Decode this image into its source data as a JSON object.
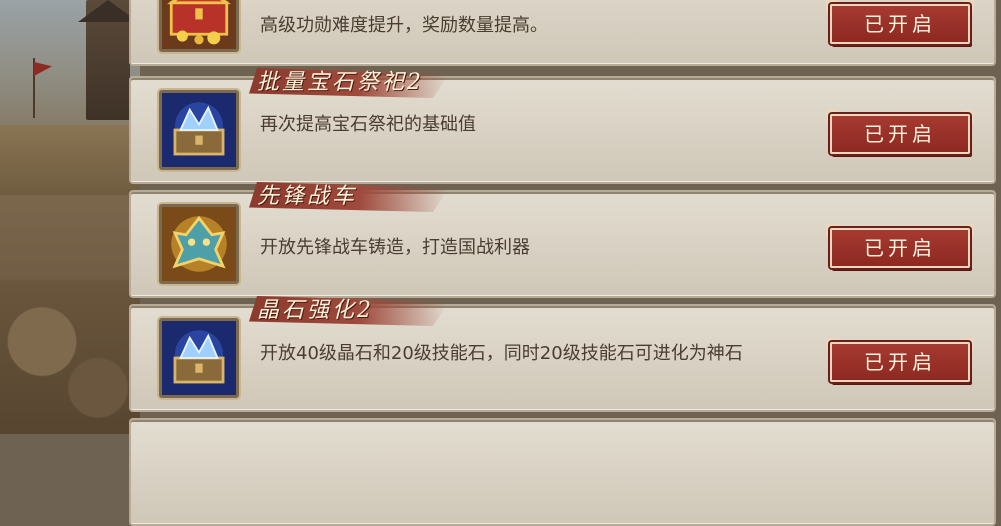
{
  "items": [
    {
      "title": "",
      "desc": "高级功勋难度提升，奖励数量提高。",
      "button": "已开启",
      "icon": "treasure-chest-icon"
    },
    {
      "title": "批量宝石祭祀2",
      "desc": "再次提高宝石祭祀的基础值",
      "button": "已开启",
      "icon": "gem-chest-icon"
    },
    {
      "title": "先锋战车",
      "desc": "开放先锋战车铸造，打造国战利器",
      "button": "已开启",
      "icon": "war-chariot-icon"
    },
    {
      "title": "晶石强化2",
      "desc": "开放40级晶石和20级技能石，同时20级技能石可进化为神石",
      "button": "已开启",
      "icon": "gem-chest-icon"
    }
  ],
  "colors": {
    "button": "#9a3128",
    "ribbon": "#8b3a2e",
    "card": "#dcd5c8"
  }
}
